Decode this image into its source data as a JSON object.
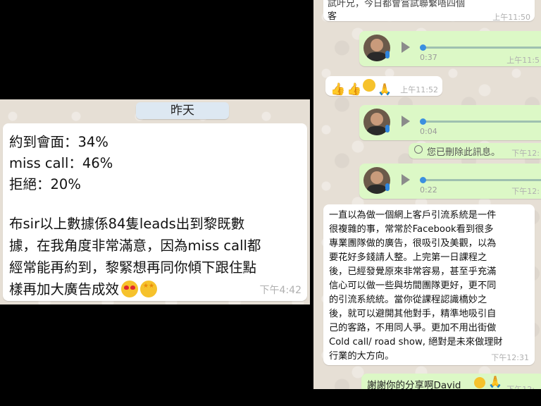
{
  "left_chat": {
    "date_label": "昨天",
    "message_lines": [
      "約到會面：34%",
      "miss call：46%",
      "拒絕：20%",
      "布sir以上數據係84隻leads出到黎既數",
      "據，在我角度非常滿意，因為miss call都",
      "經常能再約到，黎緊想再同你傾下跟住點",
      "樣再加大廣告成效"
    ],
    "emojis": [
      "heart-eyes-face-emoji",
      "star-struck-face-emoji"
    ],
    "time": "下午4:42"
  },
  "right_chat": {
    "top_message": {
      "line1": "試叶兄，今日都會嘗試聯繫唔四個",
      "line2": "客",
      "time": "上午11:50"
    },
    "voice_messages": [
      {
        "duration": "0:37",
        "time": "上午11:5"
      },
      {
        "duration": "0:04",
        "time": "下午12:"
      },
      {
        "duration": "0:22",
        "time": "下午12:"
      }
    ],
    "reaction_message": {
      "emojis": [
        "thumbs-up-emoji",
        "thumbs-up-emoji",
        "smiling-face-emoji",
        "folded-hands-emoji"
      ],
      "time": "上午11:52"
    },
    "deleted_notice": {
      "text": "您已刪除此訊息。",
      "time": "下午12:"
    },
    "long_message": {
      "lines": [
        "一直以為做一個網上客戶引流系統是一件",
        "很複雜的事，常常於Facebook看到很多",
        "專業團隊做的廣告，很吸引及美觀，以為",
        "要花好多錢請人整。上完第一日課程之",
        "後，已經發覺原來非常容易，甚至乎充滿",
        "信心可以做一些與坊間團隊更好，更不同",
        "的引流系統統。當你從課程認識橋妙之",
        "後，就可以避開其他對手，精準地吸引自",
        "己的客路，不用同人爭。更加不用出街做",
        "Cold call/ road show, 絕對是未來做理財",
        "行業的大方向。"
      ],
      "time": "下午12:31"
    },
    "thanks_message": {
      "text": "謝謝你的分享啊David",
      "time": "下午12:"
    }
  }
}
